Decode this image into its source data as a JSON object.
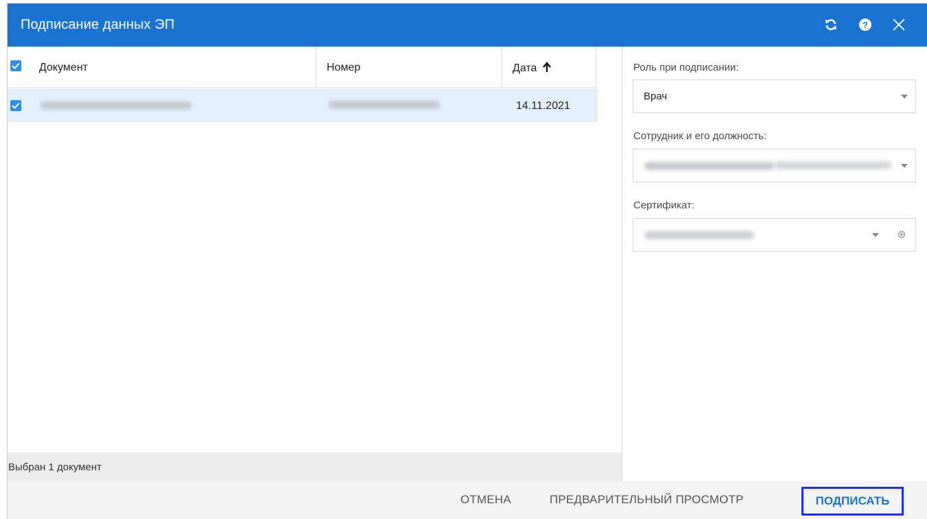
{
  "dialog": {
    "title": "Подписание данных ЭП"
  },
  "table": {
    "columns": [
      "Документ",
      "Номер",
      "Дата"
    ],
    "rows": [
      {
        "document": "Протокол консультации",
        "number": "000000001746",
        "date": "14.11.2021",
        "selected": true
      }
    ],
    "sort_indicator": "arrow-up-icon",
    "status": "Выбран 1 документ"
  },
  "panel": {
    "role_label": "Роль при подписании:",
    "role_value": "Врач",
    "employee_label": "Сотрудник и его должность:",
    "certificate_label": "Сертификат:"
  },
  "footer": {
    "cancel": "ОТМЕНА",
    "preview": "ПРЕДВАРИТЕЛЬНЫЙ ПРОСМОТР",
    "sign": "ПОДПИСАТЬ"
  },
  "colors": {
    "title_bar": "#1a73d1",
    "checkbox": "#2d8ee8",
    "selected_row": "#e3f0fc",
    "sign_button_text": "#1a73d1",
    "sign_button_border": "#1c2fe6"
  }
}
